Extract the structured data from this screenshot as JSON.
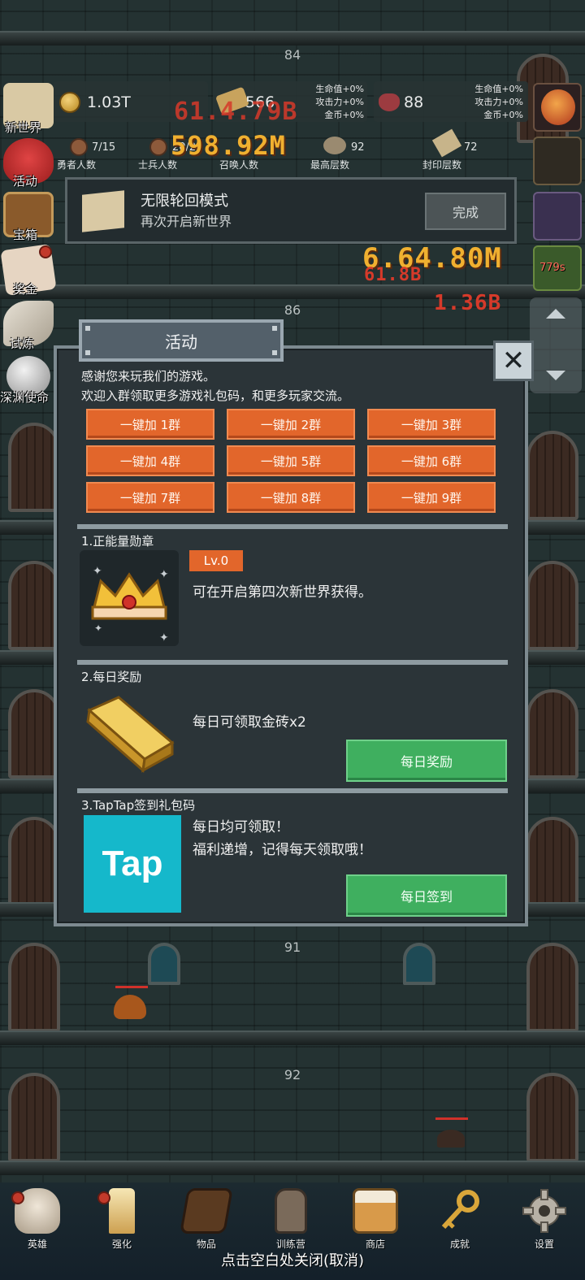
{
  "floors": {
    "f84": "84",
    "f86": "86",
    "f91": "91",
    "f92": "92"
  },
  "hud": {
    "gold": "1.03T",
    "scroll_value": "566",
    "gem_value": "88",
    "buff_left": [
      "生命值+0%",
      "攻击力+0%",
      "金币+0%"
    ],
    "buff_right": [
      "生命值+0%",
      "攻击力+0%",
      "金币+0%"
    ],
    "stats": [
      {
        "value": "7/15",
        "label": "勇者人数"
      },
      {
        "value": "20/20",
        "label": "士兵人数"
      },
      {
        "value": "",
        "label": "召唤人数"
      },
      {
        "value": "92",
        "label": "最高层数"
      },
      {
        "value": "72",
        "label": "封印层数"
      }
    ],
    "damage_texts": [
      "61.4.79B",
      "598.92M",
      "6.64.80M",
      "61.8B",
      "1.36B"
    ],
    "timer": "779s",
    "colors": {
      "damage": "#e0402b",
      "damage_gold": "#f0b030"
    }
  },
  "side_menu": [
    {
      "label": "新世界",
      "icon": "map-icon"
    },
    {
      "label": "活动",
      "icon": "heart-icon"
    },
    {
      "label": "宝箱",
      "icon": "chest-icon"
    },
    {
      "label": "奖金",
      "icon": "letter-icon"
    },
    {
      "label": "试炼",
      "icon": "feather-icon"
    },
    {
      "label": "深渊使命",
      "icon": "orb-icon"
    }
  ],
  "banner": {
    "title": "无限轮回模式",
    "subtitle": "再次开启新世界",
    "button": "完成"
  },
  "dialog": {
    "title": "活动",
    "close": "✕",
    "intro": [
      "感谢您来玩我们的游戏。",
      "欢迎入群领取更多游戏礼包码，和更多玩家交流。"
    ],
    "groups": [
      "一键加 1群",
      "一键加 2群",
      "一键加 3群",
      "一键加 4群",
      "一键加 5群",
      "一键加 6群",
      "一键加 7群",
      "一键加 8群",
      "一键加 9群"
    ],
    "section1": {
      "title": "1.正能量勋章",
      "level": "Lv.0",
      "desc": "可在开启第四次新世界获得。"
    },
    "section2": {
      "title": "2.每日奖励",
      "desc": "每日可领取金砖x2",
      "button": "每日奖励"
    },
    "section3": {
      "title": "3.TapTap签到礼包码",
      "logo_text": "Tap",
      "desc1": "每日均可领取！",
      "desc2": "福利递增，记得每天领取哦！",
      "button": "每日签到"
    }
  },
  "bottom_nav": [
    {
      "label": "英雄",
      "icon": "skull-icon"
    },
    {
      "label": "强化",
      "icon": "candle-icon"
    },
    {
      "label": "物品",
      "icon": "book-icon"
    },
    {
      "label": "训练营",
      "icon": "lantern-icon"
    },
    {
      "label": "商店",
      "icon": "mug-icon"
    },
    {
      "label": "成就",
      "icon": "key-icon"
    },
    {
      "label": "设置",
      "icon": "gear-icon"
    }
  ],
  "close_hint": "点击空白处关闭(取消)"
}
